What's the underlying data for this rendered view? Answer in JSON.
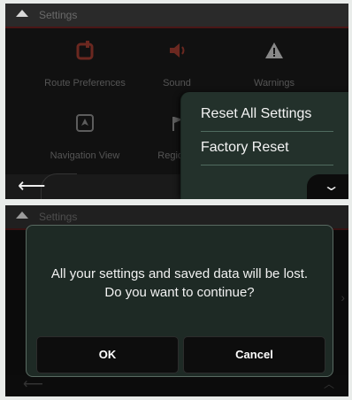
{
  "top_screen": {
    "title": "Settings",
    "tiles": [
      {
        "label": "Route Preferences",
        "icon": "route-icon"
      },
      {
        "label": "Sound",
        "icon": "speaker-icon"
      },
      {
        "label": "Warnings",
        "icon": "warning-icon"
      },
      {
        "label": "Navigation View",
        "icon": "navigation-view-icon"
      },
      {
        "label": "Regional",
        "icon": "regional-icon"
      }
    ],
    "menu": {
      "items": [
        "Reset All Settings",
        "Factory Reset"
      ]
    },
    "back_glyph": "⟵",
    "chevron_glyph": "⌄"
  },
  "bottom_screen": {
    "title": "Settings",
    "dialog": {
      "message_line1": "All your settings and saved data will be lost.",
      "message_line2": "Do you want to continue?",
      "ok_label": "OK",
      "cancel_label": "Cancel"
    }
  },
  "colors": {
    "accent_red": "#b23a2a",
    "menu_bg": "#23312b",
    "dialog_bg": "#1e2a25"
  }
}
